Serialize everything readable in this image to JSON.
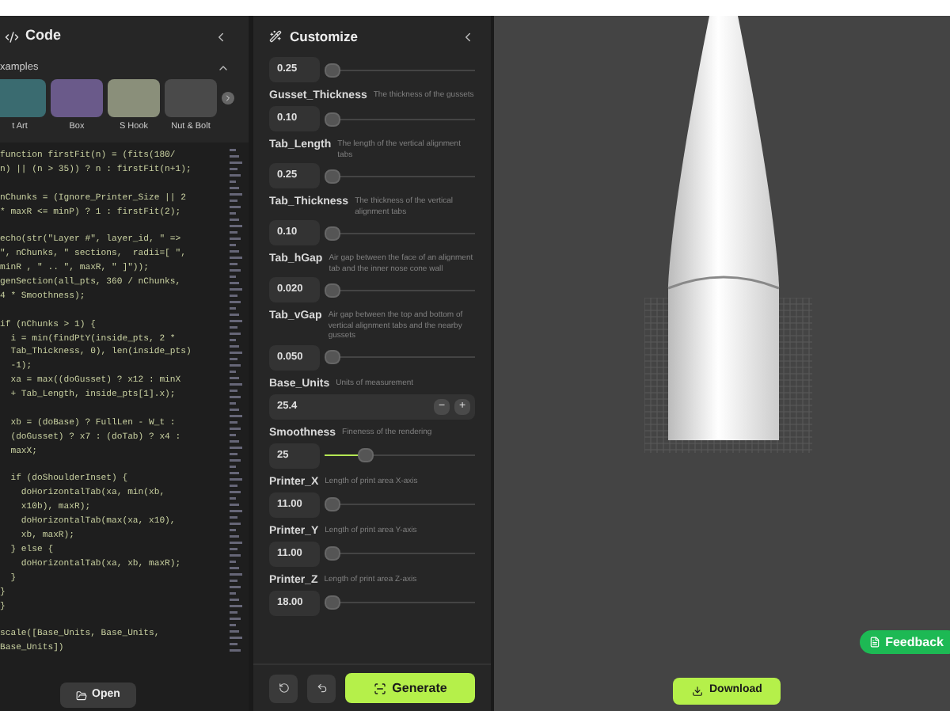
{
  "code_panel": {
    "title": "Code",
    "examples": {
      "title": "xamples",
      "expanded": true,
      "items": [
        {
          "label": "t Art"
        },
        {
          "label": "Box"
        },
        {
          "label": "S Hook"
        },
        {
          "label": "Nut & Bolt"
        }
      ]
    },
    "code_blocks": [
      [
        "function firstFit(n) = (fits(180/",
        "n) || (n > 35)) ? n : firstFit(n+1);"
      ],
      [
        "nChunks = (Ignore_Printer_Size || 2",
        "* maxR <= minP) ? 1 : firstFit(2);"
      ],
      [
        "echo(str(\"Layer #\", layer_id, \" =>",
        "\", nChunks, \" sections,  radii=[ \",",
        "minR , \" .. \", maxR, \" ]\"));",
        "genSection(all_pts, 360 / nChunks,",
        "4 * Smoothness);"
      ],
      [
        "if (nChunks > 1) {",
        "  i = min(findPtY(inside_pts, 2 *",
        "  Tab_Thickness, 0), len(inside_pts)",
        "  -1);",
        "  xa = max((doGusset) ? x12 : minX",
        "  + Tab_Length, inside_pts[1].x);"
      ],
      [
        "  xb = (doBase) ? FullLen - W_t :",
        "  (doGusset) ? x7 : (doTab) ? x4 :",
        "  maxX;"
      ],
      [
        "  if (doShoulderInset) {",
        "    doHorizontalTab(xa, min(xb,",
        "    x10b), maxR);",
        "    doHorizontalTab(max(xa, x10),",
        "    xb, maxR);",
        "  } else {",
        "    doHorizontalTab(xa, xb, maxR);",
        "  }",
        "}",
        "}"
      ],
      [
        "scale([Base_Units, Base_Units,",
        "Base_Units])"
      ]
    ],
    "open_button": "Open"
  },
  "customize_panel": {
    "title": "Customize",
    "params": [
      {
        "kind": "slider",
        "value": "0.25",
        "level": 0
      },
      {
        "kind": "slider",
        "name": "Gusset_Thickness",
        "description": "The thickness of the gussets",
        "value": "0.10",
        "level": 0
      },
      {
        "kind": "slider",
        "name": "Tab_Length",
        "description": "The length of the vertical alignment tabs",
        "value": "0.25",
        "level": 0
      },
      {
        "kind": "slider",
        "name": "Tab_Thickness",
        "description": "The thickness of the vertical alignment tabs",
        "value": "0.10",
        "level": 0
      },
      {
        "kind": "slider",
        "name": "Tab_hGap",
        "description": "Air gap between the face of an alignment tab and the inner nose cone wall",
        "value": "0.020",
        "level": 0
      },
      {
        "kind": "slider",
        "name": "Tab_vGap",
        "description": "Air gap between the top and bottom of vertical alignment tabs and the nearby gussets",
        "value": "0.050",
        "level": 0
      },
      {
        "kind": "stepper",
        "name": "Base_Units",
        "description": "Units of measurement",
        "value": "25.4",
        "minus": "−",
        "plus": "+"
      },
      {
        "kind": "slider",
        "name": "Smoothness",
        "description": "Fineness of the rendering",
        "value": "25",
        "level": 0.25
      },
      {
        "kind": "slider",
        "name": "Printer_X",
        "description": "Length of print area X-axis",
        "value": "11.00",
        "level": 0
      },
      {
        "kind": "slider",
        "name": "Printer_Y",
        "description": "Length of print area Y-axis",
        "value": "11.00",
        "level": 0
      },
      {
        "kind": "slider",
        "name": "Printer_Z",
        "description": "Length of print area Z-axis",
        "value": "18.00",
        "level": 0
      }
    ],
    "generate_button": "Generate"
  },
  "viewport": {
    "download_button": "Download",
    "feedback_button": "Feedback"
  }
}
